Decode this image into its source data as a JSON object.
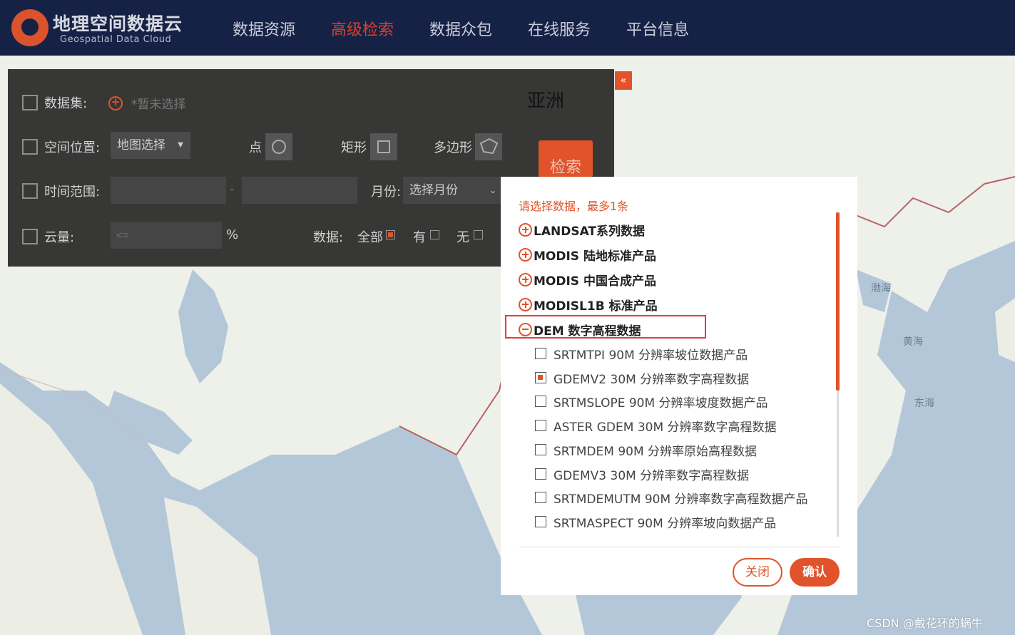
{
  "logo": {
    "cn": "地理空间数据云",
    "en": "Geospatial Data Cloud"
  },
  "nav": [
    {
      "label": "数据资源",
      "active": false
    },
    {
      "label": "高级检索",
      "active": true
    },
    {
      "label": "数据众包",
      "active": false
    },
    {
      "label": "在线服务",
      "active": false
    },
    {
      "label": "平台信息",
      "active": false
    }
  ],
  "panel": {
    "collapse_label": "«",
    "dataset_label": "数据集:",
    "dataset_placeholder": "*暂未选择",
    "location_label": "空间位置:",
    "location_select": "地图选择",
    "point_label": "点",
    "rect_label": "矩形",
    "polygon_label": "多边形",
    "time_label": "时间范围:",
    "time_separator": "-",
    "month_label": "月份:",
    "month_select": "选择月份",
    "cloud_label": "云量:",
    "cloud_placeholder": "<=",
    "cloud_unit": "%",
    "data_label": "数据:",
    "opt_all": "全部",
    "opt_has": "有",
    "opt_none": "无",
    "region_label": "亚洲",
    "search_button": "检索"
  },
  "modal": {
    "hint": "请选择数据，最多1条",
    "categories": [
      {
        "label": "LANDSAT系列数据",
        "expanded": false
      },
      {
        "label": "MODIS 陆地标准产品",
        "expanded": false
      },
      {
        "label": "MODIS 中国合成产品",
        "expanded": false
      },
      {
        "label": "MODISL1B 标准产品",
        "expanded": false
      },
      {
        "label": "DEM 数字高程数据",
        "expanded": true
      }
    ],
    "dem_items": [
      {
        "label": "SRTMTPI 90M 分辨率坡位数据产品",
        "checked": false
      },
      {
        "label": "GDEMV2 30M 分辨率数字高程数据",
        "checked": true
      },
      {
        "label": "SRTMSLOPE 90M 分辨率坡度数据产品",
        "checked": false
      },
      {
        "label": "ASTER GDEM 30M 分辨率数字高程数据",
        "checked": false
      },
      {
        "label": "SRTMDEM 90M 分辨率原始高程数据",
        "checked": false
      },
      {
        "label": "GDEMV3 30M 分辨率数字高程数据",
        "checked": false
      },
      {
        "label": "SRTMDEMUTM 90M 分辨率数字高程数据产品",
        "checked": false
      },
      {
        "label": "SRTMASPECT 90M 分辨率坡向数据产品",
        "checked": false
      }
    ],
    "close_button": "关闭",
    "confirm_button": "确认"
  },
  "map_labels": {
    "bohai": "渤海",
    "huanghai": "黄海",
    "donghai": "东海"
  },
  "watermark": "CSDN @戴花环的蜗牛",
  "colors": {
    "accent": "#e0532b",
    "navbar": "#162146",
    "highlight": "#e33c3c"
  }
}
